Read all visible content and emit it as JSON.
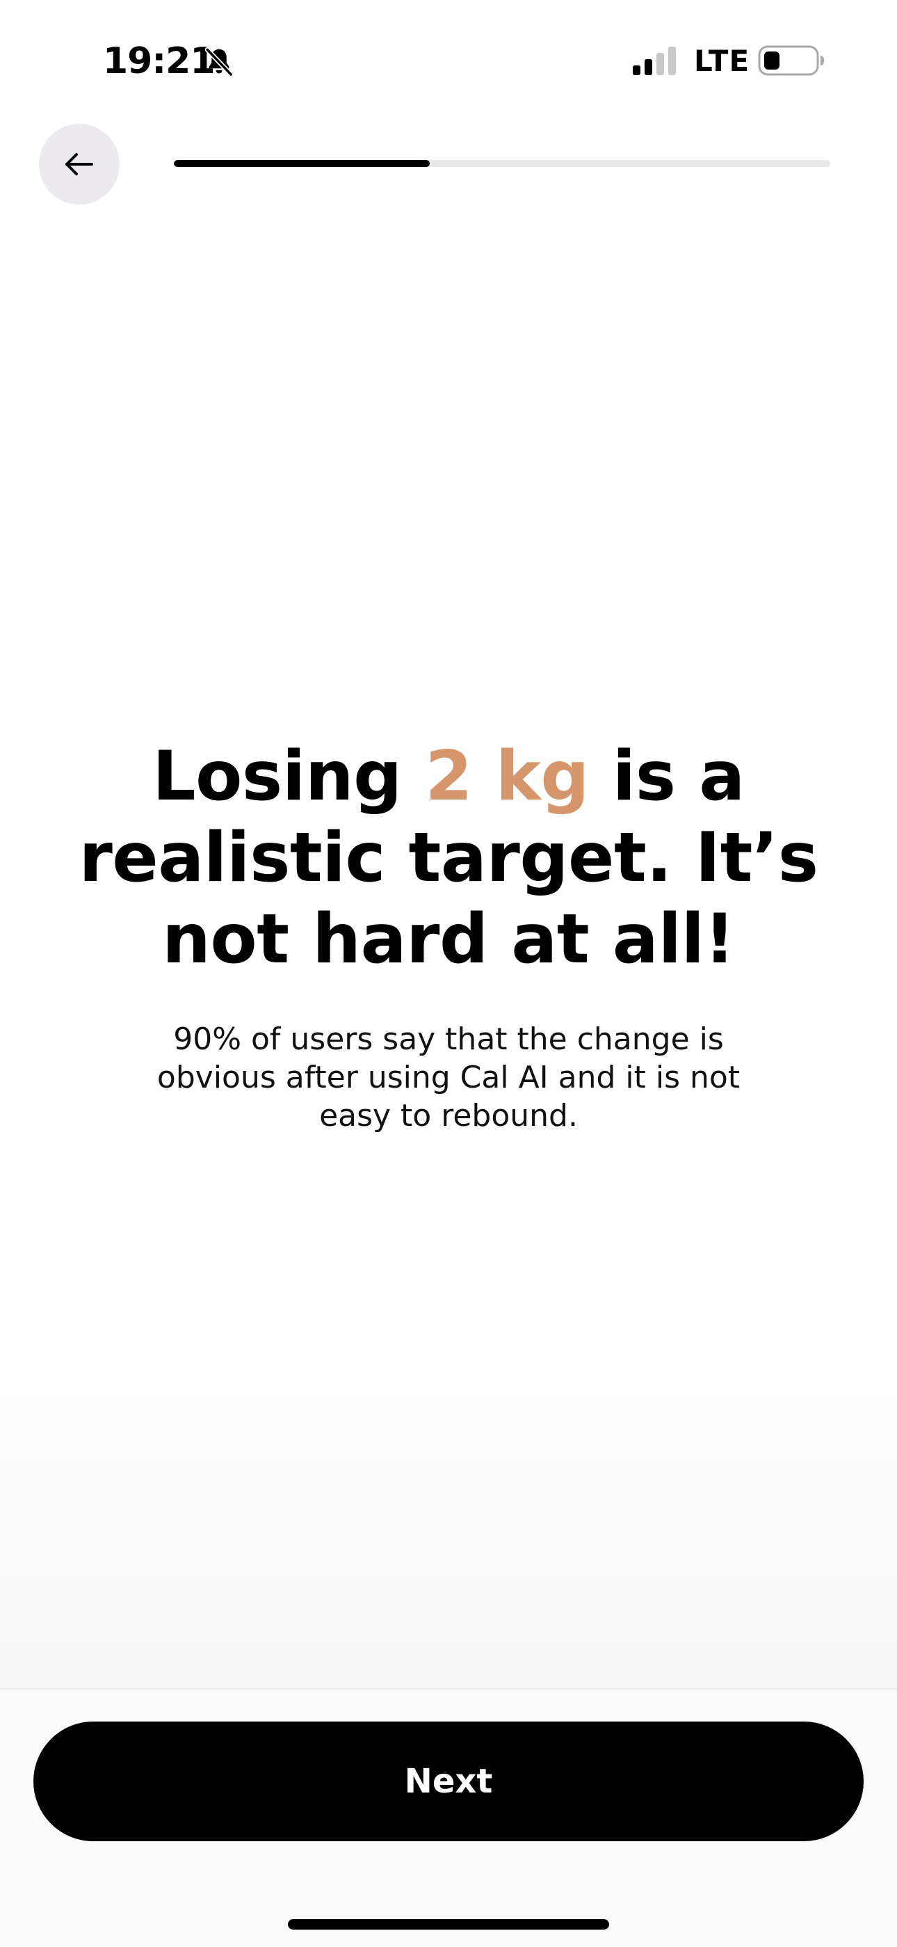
{
  "status_bar": {
    "time": "19:21",
    "network": "LTE",
    "icons": [
      "bell-slash-icon",
      "cellular-signal-icon",
      "battery-icon"
    ]
  },
  "nav": {
    "back_icon": "arrow-left-icon",
    "progress_fraction": 0.39
  },
  "content": {
    "headline_prefix": "Losing ",
    "headline_accent": "2 kg",
    "headline_suffix": " is a realistic target. It’s not hard at all!",
    "subtitle": "90% of users say that the change is obvious after using Cal AI and it is not easy to rebound."
  },
  "footer": {
    "next_label": "Next"
  },
  "colors": {
    "accent": "#d5966c",
    "primary": "#000000",
    "back_button_bg": "#ece9ef",
    "progress_track": "#e8e8e8"
  }
}
